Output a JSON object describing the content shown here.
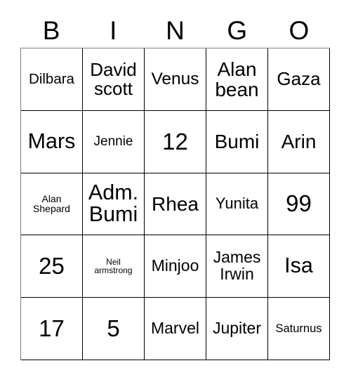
{
  "card": {
    "title": "BINGO",
    "headers": [
      "B",
      "I",
      "N",
      "G",
      "O"
    ],
    "grid_columns": 5,
    "grid_rows": 5,
    "border_color": "#000000",
    "background_color": "#ffffff",
    "text_color": "#000000"
  },
  "rows": [
    {
      "cells": [
        {
          "text": "Dilbara",
          "size": "fs-20"
        },
        {
          "text": "David\nscott",
          "size": "fs-26"
        },
        {
          "text": "Venus",
          "size": "fs-24"
        },
        {
          "text": "Alan\nbean",
          "size": "fs-28"
        },
        {
          "text": "Gaza",
          "size": "fs-26"
        }
      ]
    },
    {
      "cells": [
        {
          "text": "Mars",
          "size": "fs-30"
        },
        {
          "text": "Jennie",
          "size": "fs-19"
        },
        {
          "text": "12",
          "size": "fs-32"
        },
        {
          "text": "Bumi",
          "size": "fs-28"
        },
        {
          "text": "Arin",
          "size": "fs-28"
        }
      ]
    },
    {
      "cells": [
        {
          "text": "Alan\nShepard",
          "size": "fs-14"
        },
        {
          "text": "Adm.\nBumi",
          "size": "fs-30"
        },
        {
          "text": "Rhea",
          "size": "fs-28"
        },
        {
          "text": "Yunita",
          "size": "fs-22"
        },
        {
          "text": "99",
          "size": "fs-32"
        }
      ]
    },
    {
      "cells": [
        {
          "text": "25",
          "size": "fs-32"
        },
        {
          "text": "Neil\narmstrong",
          "size": "fs-12"
        },
        {
          "text": "Minjoo",
          "size": "fs-23"
        },
        {
          "text": "James\nIrwin",
          "size": "fs-23"
        },
        {
          "text": "Isa",
          "size": "fs-30"
        }
      ]
    },
    {
      "cells": [
        {
          "text": "17",
          "size": "fs-32"
        },
        {
          "text": "5",
          "size": "fs-32"
        },
        {
          "text": "Marvel",
          "size": "fs-23"
        },
        {
          "text": "Jupiter",
          "size": "fs-23"
        },
        {
          "text": "Saturnus",
          "size": "fs-16"
        }
      ]
    }
  ]
}
